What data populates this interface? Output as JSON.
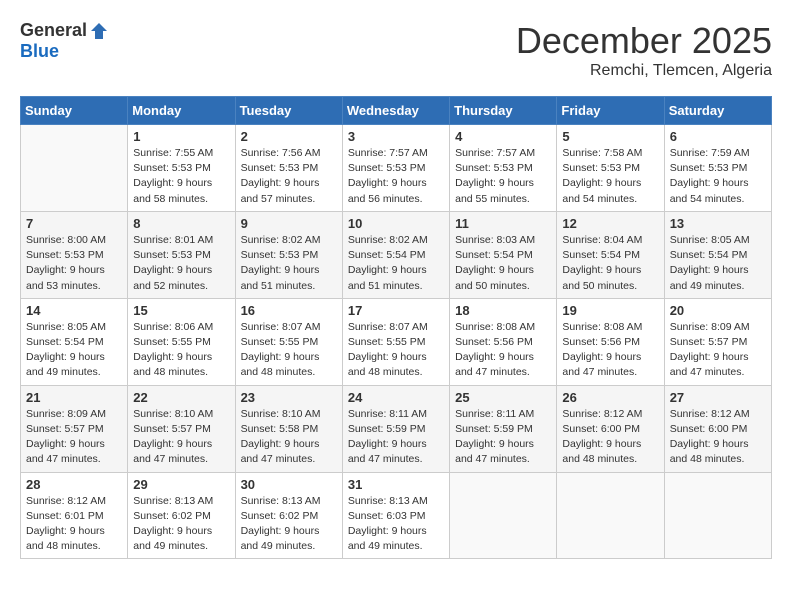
{
  "header": {
    "logo_general": "General",
    "logo_blue": "Blue",
    "month_year": "December 2025",
    "location": "Remchi, Tlemcen, Algeria"
  },
  "weekdays": [
    "Sunday",
    "Monday",
    "Tuesday",
    "Wednesday",
    "Thursday",
    "Friday",
    "Saturday"
  ],
  "weeks": [
    [
      {
        "day": "",
        "info": ""
      },
      {
        "day": "1",
        "info": "Sunrise: 7:55 AM\nSunset: 5:53 PM\nDaylight: 9 hours\nand 58 minutes."
      },
      {
        "day": "2",
        "info": "Sunrise: 7:56 AM\nSunset: 5:53 PM\nDaylight: 9 hours\nand 57 minutes."
      },
      {
        "day": "3",
        "info": "Sunrise: 7:57 AM\nSunset: 5:53 PM\nDaylight: 9 hours\nand 56 minutes."
      },
      {
        "day": "4",
        "info": "Sunrise: 7:57 AM\nSunset: 5:53 PM\nDaylight: 9 hours\nand 55 minutes."
      },
      {
        "day": "5",
        "info": "Sunrise: 7:58 AM\nSunset: 5:53 PM\nDaylight: 9 hours\nand 54 minutes."
      },
      {
        "day": "6",
        "info": "Sunrise: 7:59 AM\nSunset: 5:53 PM\nDaylight: 9 hours\nand 54 minutes."
      }
    ],
    [
      {
        "day": "7",
        "info": "Sunrise: 8:00 AM\nSunset: 5:53 PM\nDaylight: 9 hours\nand 53 minutes."
      },
      {
        "day": "8",
        "info": "Sunrise: 8:01 AM\nSunset: 5:53 PM\nDaylight: 9 hours\nand 52 minutes."
      },
      {
        "day": "9",
        "info": "Sunrise: 8:02 AM\nSunset: 5:53 PM\nDaylight: 9 hours\nand 51 minutes."
      },
      {
        "day": "10",
        "info": "Sunrise: 8:02 AM\nSunset: 5:54 PM\nDaylight: 9 hours\nand 51 minutes."
      },
      {
        "day": "11",
        "info": "Sunrise: 8:03 AM\nSunset: 5:54 PM\nDaylight: 9 hours\nand 50 minutes."
      },
      {
        "day": "12",
        "info": "Sunrise: 8:04 AM\nSunset: 5:54 PM\nDaylight: 9 hours\nand 50 minutes."
      },
      {
        "day": "13",
        "info": "Sunrise: 8:05 AM\nSunset: 5:54 PM\nDaylight: 9 hours\nand 49 minutes."
      }
    ],
    [
      {
        "day": "14",
        "info": "Sunrise: 8:05 AM\nSunset: 5:54 PM\nDaylight: 9 hours\nand 49 minutes."
      },
      {
        "day": "15",
        "info": "Sunrise: 8:06 AM\nSunset: 5:55 PM\nDaylight: 9 hours\nand 48 minutes."
      },
      {
        "day": "16",
        "info": "Sunrise: 8:07 AM\nSunset: 5:55 PM\nDaylight: 9 hours\nand 48 minutes."
      },
      {
        "day": "17",
        "info": "Sunrise: 8:07 AM\nSunset: 5:55 PM\nDaylight: 9 hours\nand 48 minutes."
      },
      {
        "day": "18",
        "info": "Sunrise: 8:08 AM\nSunset: 5:56 PM\nDaylight: 9 hours\nand 47 minutes."
      },
      {
        "day": "19",
        "info": "Sunrise: 8:08 AM\nSunset: 5:56 PM\nDaylight: 9 hours\nand 47 minutes."
      },
      {
        "day": "20",
        "info": "Sunrise: 8:09 AM\nSunset: 5:57 PM\nDaylight: 9 hours\nand 47 minutes."
      }
    ],
    [
      {
        "day": "21",
        "info": "Sunrise: 8:09 AM\nSunset: 5:57 PM\nDaylight: 9 hours\nand 47 minutes."
      },
      {
        "day": "22",
        "info": "Sunrise: 8:10 AM\nSunset: 5:57 PM\nDaylight: 9 hours\nand 47 minutes."
      },
      {
        "day": "23",
        "info": "Sunrise: 8:10 AM\nSunset: 5:58 PM\nDaylight: 9 hours\nand 47 minutes."
      },
      {
        "day": "24",
        "info": "Sunrise: 8:11 AM\nSunset: 5:59 PM\nDaylight: 9 hours\nand 47 minutes."
      },
      {
        "day": "25",
        "info": "Sunrise: 8:11 AM\nSunset: 5:59 PM\nDaylight: 9 hours\nand 47 minutes."
      },
      {
        "day": "26",
        "info": "Sunrise: 8:12 AM\nSunset: 6:00 PM\nDaylight: 9 hours\nand 48 minutes."
      },
      {
        "day": "27",
        "info": "Sunrise: 8:12 AM\nSunset: 6:00 PM\nDaylight: 9 hours\nand 48 minutes."
      }
    ],
    [
      {
        "day": "28",
        "info": "Sunrise: 8:12 AM\nSunset: 6:01 PM\nDaylight: 9 hours\nand 48 minutes."
      },
      {
        "day": "29",
        "info": "Sunrise: 8:13 AM\nSunset: 6:02 PM\nDaylight: 9 hours\nand 49 minutes."
      },
      {
        "day": "30",
        "info": "Sunrise: 8:13 AM\nSunset: 6:02 PM\nDaylight: 9 hours\nand 49 minutes."
      },
      {
        "day": "31",
        "info": "Sunrise: 8:13 AM\nSunset: 6:03 PM\nDaylight: 9 hours\nand 49 minutes."
      },
      {
        "day": "",
        "info": ""
      },
      {
        "day": "",
        "info": ""
      },
      {
        "day": "",
        "info": ""
      }
    ]
  ]
}
